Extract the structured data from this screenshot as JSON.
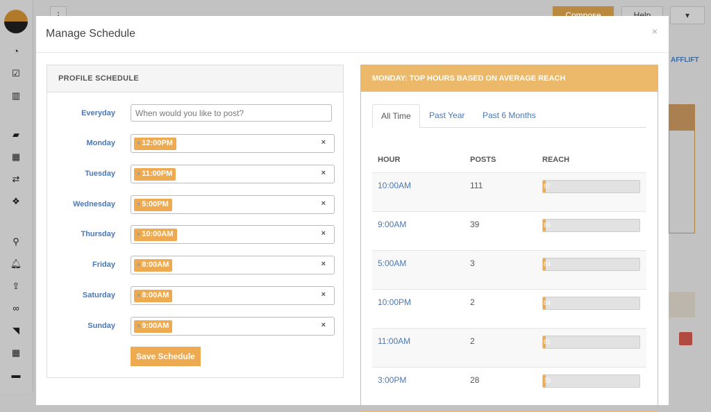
{
  "app": {
    "compose_label": "Compose",
    "help_label": "Help",
    "side_link": "AFFLIFT",
    "sidebar_icons": [
      "dashboard-icon",
      "calendar-check-icon",
      "bar-chart-icon",
      "folder-icon",
      "calendar-icon",
      "exchange-icon",
      "cubes-icon",
      "search-icon",
      "bell-icon",
      "upload-icon",
      "link-icon",
      "rss-icon",
      "table-icon",
      "briefcase-icon"
    ]
  },
  "modal": {
    "title": "Manage Schedule",
    "close": "×"
  },
  "schedule": {
    "title": "PROFILE SCHEDULE",
    "everyday_label": "Everyday",
    "everyday_placeholder": "When would you like to post?",
    "days": [
      {
        "day": "Monday",
        "time": "12:00PM"
      },
      {
        "day": "Tuesday",
        "time": "11:00PM"
      },
      {
        "day": "Wednesday",
        "time": "5:00PM"
      },
      {
        "day": "Thursday",
        "time": "10:00AM"
      },
      {
        "day": "Friday",
        "time": "8:00AM"
      },
      {
        "day": "Saturday",
        "time": "8:00AM"
      },
      {
        "day": "Sunday",
        "time": "9:00AM"
      }
    ],
    "save_label": "Save Schedule"
  },
  "top_hours": {
    "title": "MONDAY: TOP HOURS BASED ON AVERAGE REACH",
    "tabs": [
      {
        "label": "All Time",
        "active": true
      },
      {
        "label": "Past Year"
      },
      {
        "label": "Past 6 Months"
      }
    ],
    "columns": [
      "HOUR",
      "POSTS",
      "REACH"
    ],
    "rows": [
      {
        "hour": "10:00AM",
        "posts": "111",
        "reach": "87"
      },
      {
        "hour": "9:00AM",
        "posts": "39",
        "reach": "85"
      },
      {
        "hour": "5:00AM",
        "posts": "3",
        "reach": "84"
      },
      {
        "hour": "10:00PM",
        "posts": "2",
        "reach": "84"
      },
      {
        "hour": "11:00AM",
        "posts": "2",
        "reach": "81"
      },
      {
        "hour": "3:00PM",
        "posts": "28",
        "reach": "79"
      }
    ]
  },
  "colors": {
    "accent": "#eeaa50",
    "header": "#ecb86a",
    "link": "#4a78b5"
  }
}
